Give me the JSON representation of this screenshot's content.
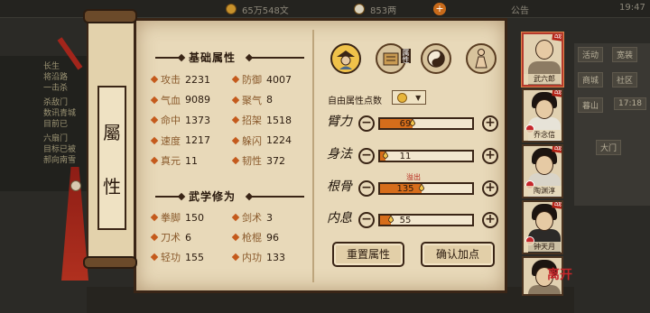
{
  "hud": {
    "money": "65万548文",
    "silver": "853两",
    "announcement": "公告",
    "time": "19:47"
  },
  "background_quest": {
    "lines": [
      "长生",
      "将沿路",
      "一击杀",
      "杀敌门",
      "数讯青城",
      "目前已",
      "六扇门",
      "目标已被",
      "郝向南雪"
    ]
  },
  "background_side": {
    "buttons": [
      "活动",
      "宽装",
      "商城",
      "社区",
      "暮山",
      "17:18",
      "大门"
    ]
  },
  "scroll": {
    "title_top": "屬",
    "title_bottom": "性"
  },
  "base_attributes": {
    "title": "基础属性",
    "stats": [
      {
        "label": "攻击",
        "value": "2231"
      },
      {
        "label": "防御",
        "value": "4007"
      },
      {
        "label": "气血",
        "value": "9089"
      },
      {
        "label": "聚气",
        "value": "8"
      },
      {
        "label": "命中",
        "value": "1373"
      },
      {
        "label": "招架",
        "value": "1518"
      },
      {
        "label": "速度",
        "value": "1217"
      },
      {
        "label": "躲闪",
        "value": "1224"
      },
      {
        "label": "真元",
        "value": "11"
      },
      {
        "label": "韧性",
        "value": "372"
      }
    ]
  },
  "martial_arts": {
    "title": "武学修为",
    "stats": [
      {
        "label": "拳脚",
        "value": "150"
      },
      {
        "label": "剑术",
        "value": "3"
      },
      {
        "label": "刀术",
        "value": "6"
      },
      {
        "label": "枪棍",
        "value": "96"
      },
      {
        "label": "轻功",
        "value": "155"
      },
      {
        "label": "内功",
        "value": "133"
      }
    ]
  },
  "tabs": {
    "items": [
      {
        "icon": "character-icon",
        "tag": ""
      },
      {
        "icon": "attribute-scroll-icon",
        "tag": "属性"
      },
      {
        "icon": "taiji-icon",
        "tag": ""
      },
      {
        "icon": "meridian-figure-icon",
        "tag": ""
      }
    ]
  },
  "free_points": {
    "label": "自由属性点数",
    "value": "0"
  },
  "attributes": [
    {
      "name": "臂力",
      "value": "69",
      "fill": 0.35
    },
    {
      "name": "身法",
      "value": "11",
      "fill": 0.06
    },
    {
      "name": "根骨",
      "value": "135",
      "fill": 0.45
    },
    {
      "name": "内息",
      "value": "55",
      "fill": 0.12
    }
  ],
  "overflow_label": "溢出",
  "buttons": {
    "reset": "重置属性",
    "confirm": "确认加点"
  },
  "portraits": [
    {
      "name": "武六郎",
      "badge": "战",
      "bald": true
    },
    {
      "name": "乔念信",
      "badge": "战",
      "bald": false
    },
    {
      "name": "陶渊淳",
      "badge": "战",
      "bald": false
    },
    {
      "name": "钟天月",
      "badge": "战",
      "bald": false
    },
    {
      "name": "",
      "badge": "",
      "bald": false
    }
  ],
  "leave_label": "离开",
  "colors": {
    "parchment": "#e8d9b9",
    "bar_fill": "#d66d1b",
    "accent_red": "#b52418"
  }
}
